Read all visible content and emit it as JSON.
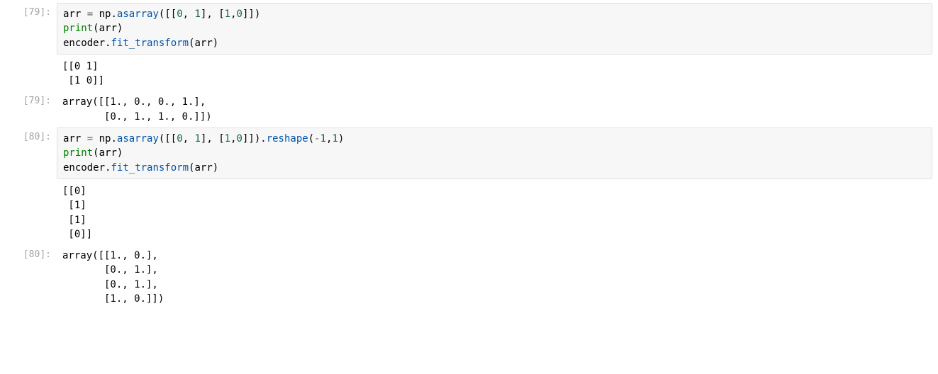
{
  "cells": [
    {
      "prompt": "[79]:",
      "type": "code",
      "source": [
        [
          {
            "t": "arr ",
            "c": "tok-var"
          },
          {
            "t": "=",
            "c": "tok-op"
          },
          {
            "t": " np",
            "c": "tok-var"
          },
          {
            "t": ".",
            "c": "tok-punct"
          },
          {
            "t": "asarray",
            "c": "tok-func"
          },
          {
            "t": "([[",
            "c": "tok-punct"
          },
          {
            "t": "0",
            "c": "tok-num"
          },
          {
            "t": ", ",
            "c": "tok-punct"
          },
          {
            "t": "1",
            "c": "tok-num"
          },
          {
            "t": "], [",
            "c": "tok-punct"
          },
          {
            "t": "1",
            "c": "tok-num"
          },
          {
            "t": ",",
            "c": "tok-punct"
          },
          {
            "t": "0",
            "c": "tok-num"
          },
          {
            "t": "]])",
            "c": "tok-punct"
          }
        ],
        [
          {
            "t": "print",
            "c": "tok-builtin"
          },
          {
            "t": "(arr)",
            "c": "tok-punct"
          }
        ],
        [
          {
            "t": "encoder",
            "c": "tok-var"
          },
          {
            "t": ".",
            "c": "tok-punct"
          },
          {
            "t": "fit_transform",
            "c": "tok-func"
          },
          {
            "t": "(arr)",
            "c": "tok-punct"
          }
        ]
      ]
    },
    {
      "prompt": "",
      "type": "stdout",
      "text": "[[0 1]\n [1 0]]"
    },
    {
      "prompt": "[79]:",
      "type": "result",
      "text": "array([[1., 0., 0., 1.],\n       [0., 1., 1., 0.]])"
    },
    {
      "prompt": "[80]:",
      "type": "code",
      "source": [
        [
          {
            "t": "arr ",
            "c": "tok-var"
          },
          {
            "t": "=",
            "c": "tok-op"
          },
          {
            "t": " np",
            "c": "tok-var"
          },
          {
            "t": ".",
            "c": "tok-punct"
          },
          {
            "t": "asarray",
            "c": "tok-func"
          },
          {
            "t": "([[",
            "c": "tok-punct"
          },
          {
            "t": "0",
            "c": "tok-num"
          },
          {
            "t": ", ",
            "c": "tok-punct"
          },
          {
            "t": "1",
            "c": "tok-num"
          },
          {
            "t": "], [",
            "c": "tok-punct"
          },
          {
            "t": "1",
            "c": "tok-num"
          },
          {
            "t": ",",
            "c": "tok-punct"
          },
          {
            "t": "0",
            "c": "tok-num"
          },
          {
            "t": "]])",
            "c": "tok-punct"
          },
          {
            "t": ".",
            "c": "tok-punct"
          },
          {
            "t": "reshape",
            "c": "tok-func"
          },
          {
            "t": "(",
            "c": "tok-punct"
          },
          {
            "t": "-",
            "c": "tok-op"
          },
          {
            "t": "1",
            "c": "tok-num"
          },
          {
            "t": ",",
            "c": "tok-punct"
          },
          {
            "t": "1",
            "c": "tok-num"
          },
          {
            "t": ")",
            "c": "tok-punct"
          }
        ],
        [
          {
            "t": "print",
            "c": "tok-builtin"
          },
          {
            "t": "(arr)",
            "c": "tok-punct"
          }
        ],
        [
          {
            "t": "encoder",
            "c": "tok-var"
          },
          {
            "t": ".",
            "c": "tok-punct"
          },
          {
            "t": "fit_transform",
            "c": "tok-func"
          },
          {
            "t": "(arr)",
            "c": "tok-punct"
          }
        ]
      ]
    },
    {
      "prompt": "",
      "type": "stdout",
      "text": "[[0]\n [1]\n [1]\n [0]]"
    },
    {
      "prompt": "[80]:",
      "type": "result",
      "text": "array([[1., 0.],\n       [0., 1.],\n       [0., 1.],\n       [1., 0.]])"
    }
  ]
}
